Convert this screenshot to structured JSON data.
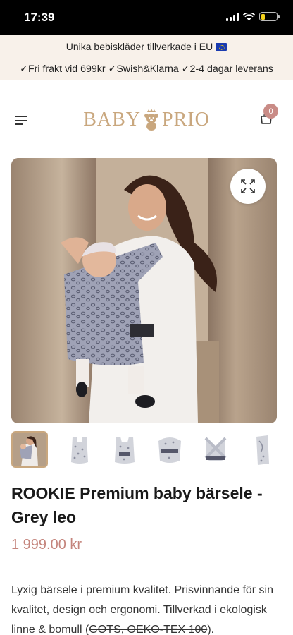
{
  "status_bar": {
    "time": "17:39",
    "battery_level": 0.25,
    "battery_color": "#f4d11a"
  },
  "promo": {
    "line1": "Unika bebiskläder tillverkade i EU",
    "line2": "✓Fri frakt vid 699kr ✓Swish&Klarna ✓2-4 dagar leverans",
    "flag_icon": "eu-flag-icon"
  },
  "header": {
    "logo_text_left": "BABY",
    "logo_text_right": "PRIO",
    "logo_icon": "teddy-bear-crown-icon",
    "cart_count": "0",
    "accent_color": "#c9a77e",
    "badge_color": "#c98b86"
  },
  "gallery": {
    "main_image": "woman-with-baby-in-grey-leopard-carrier",
    "expand_icon": "expand-arrows-icon",
    "thumbnails": [
      {
        "name": "thumb-woman-with-baby",
        "active": true
      },
      {
        "name": "thumb-carrier-front"
      },
      {
        "name": "thumb-carrier-front-alt"
      },
      {
        "name": "thumb-carrier-hood"
      },
      {
        "name": "thumb-carrier-back"
      },
      {
        "name": "thumb-carrier-folded"
      }
    ]
  },
  "product": {
    "title": "ROOKIE Premium baby bärsele - Grey leo",
    "price": "1 999.00 kr",
    "price_color": "#c4847c",
    "description_part1": "Lyxig bärsele i premium kvalitet. Prisvinnande för sin kvalitet, design och ergonomi. Tillverkad i ekologisk linne & bomull (",
    "description_strike": "GOTS, OEKO-TEX 100",
    "description_part2": ")."
  }
}
